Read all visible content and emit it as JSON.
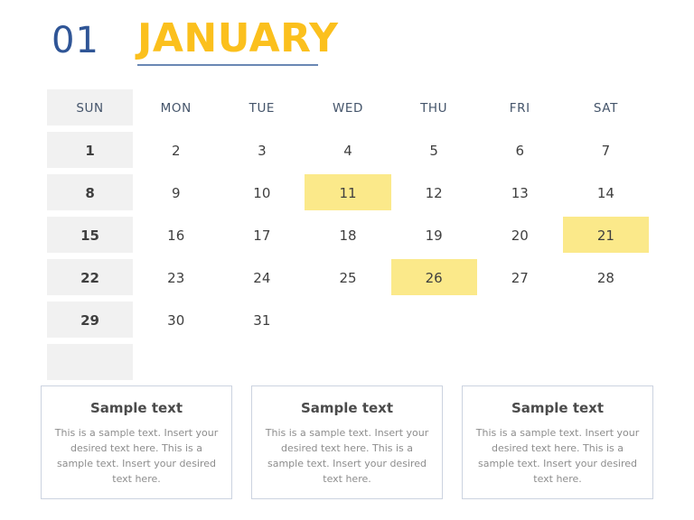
{
  "header": {
    "month_number": "01",
    "month_name": "JANUARY",
    "underline_color": "#6a87b4",
    "month_number_color": "#2f5596",
    "month_name_color": "#fbc01d"
  },
  "calendar": {
    "day_headers": [
      "SUN",
      "MON",
      "TUE",
      "WED",
      "THU",
      "FRI",
      "SAT"
    ],
    "sunday_column_bg": "#f1f1f1",
    "highlight_color": "#fbe98a",
    "weeks": [
      [
        {
          "day": "1",
          "highlight": false
        },
        {
          "day": "2",
          "highlight": false
        },
        {
          "day": "3",
          "highlight": false
        },
        {
          "day": "4",
          "highlight": false
        },
        {
          "day": "5",
          "highlight": false
        },
        {
          "day": "6",
          "highlight": false
        },
        {
          "day": "7",
          "highlight": false
        }
      ],
      [
        {
          "day": "8",
          "highlight": false
        },
        {
          "day": "9",
          "highlight": false
        },
        {
          "day": "10",
          "highlight": false
        },
        {
          "day": "11",
          "highlight": true
        },
        {
          "day": "12",
          "highlight": false
        },
        {
          "day": "13",
          "highlight": false
        },
        {
          "day": "14",
          "highlight": false
        }
      ],
      [
        {
          "day": "15",
          "highlight": false
        },
        {
          "day": "16",
          "highlight": false
        },
        {
          "day": "17",
          "highlight": false
        },
        {
          "day": "18",
          "highlight": false
        },
        {
          "day": "19",
          "highlight": false
        },
        {
          "day": "20",
          "highlight": false
        },
        {
          "day": "21",
          "highlight": true
        }
      ],
      [
        {
          "day": "22",
          "highlight": false
        },
        {
          "day": "23",
          "highlight": false
        },
        {
          "day": "24",
          "highlight": false
        },
        {
          "day": "25",
          "highlight": false
        },
        {
          "day": "26",
          "highlight": true
        },
        {
          "day": "27",
          "highlight": false
        },
        {
          "day": "28",
          "highlight": false
        }
      ],
      [
        {
          "day": "29",
          "highlight": false
        },
        {
          "day": "30",
          "highlight": false
        },
        {
          "day": "31",
          "highlight": false
        },
        {
          "day": "",
          "highlight": false
        },
        {
          "day": "",
          "highlight": false
        },
        {
          "day": "",
          "highlight": false
        },
        {
          "day": "",
          "highlight": false
        }
      ],
      [
        {
          "day": "",
          "highlight": false
        },
        {
          "day": "",
          "highlight": false
        },
        {
          "day": "",
          "highlight": false
        },
        {
          "day": "",
          "highlight": false
        },
        {
          "day": "",
          "highlight": false
        },
        {
          "day": "",
          "highlight": false
        },
        {
          "day": "",
          "highlight": false
        }
      ]
    ]
  },
  "notes": [
    {
      "title": "Sample text",
      "body": "This is a sample text. Insert your desired text here. This is a sample text. Insert your desired text here."
    },
    {
      "title": "Sample text",
      "body": "This is a sample text. Insert your desired text here. This is a sample text. Insert your desired text here."
    },
    {
      "title": "Sample text",
      "body": "This is a sample text. Insert your desired text here. This is a sample text. Insert your desired text here."
    }
  ]
}
